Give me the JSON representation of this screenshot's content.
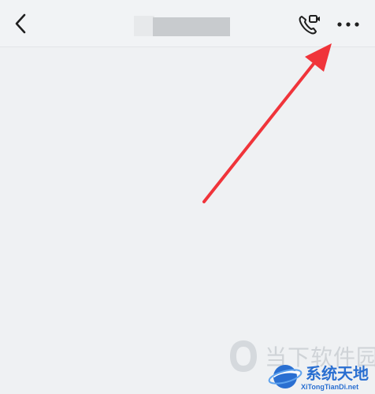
{
  "header": {
    "back_icon": "chevron-left-icon",
    "call_icon": "phone-video-call-icon",
    "more_icon": "more-dots-icon"
  },
  "annotation": {
    "arrow_color": "#f0343a"
  },
  "watermark": {
    "primary_text": "当下软件园",
    "secondary_text": "系统天地",
    "url": "XiTongTianDi.net",
    "brand_color": "#2a6fd1"
  }
}
